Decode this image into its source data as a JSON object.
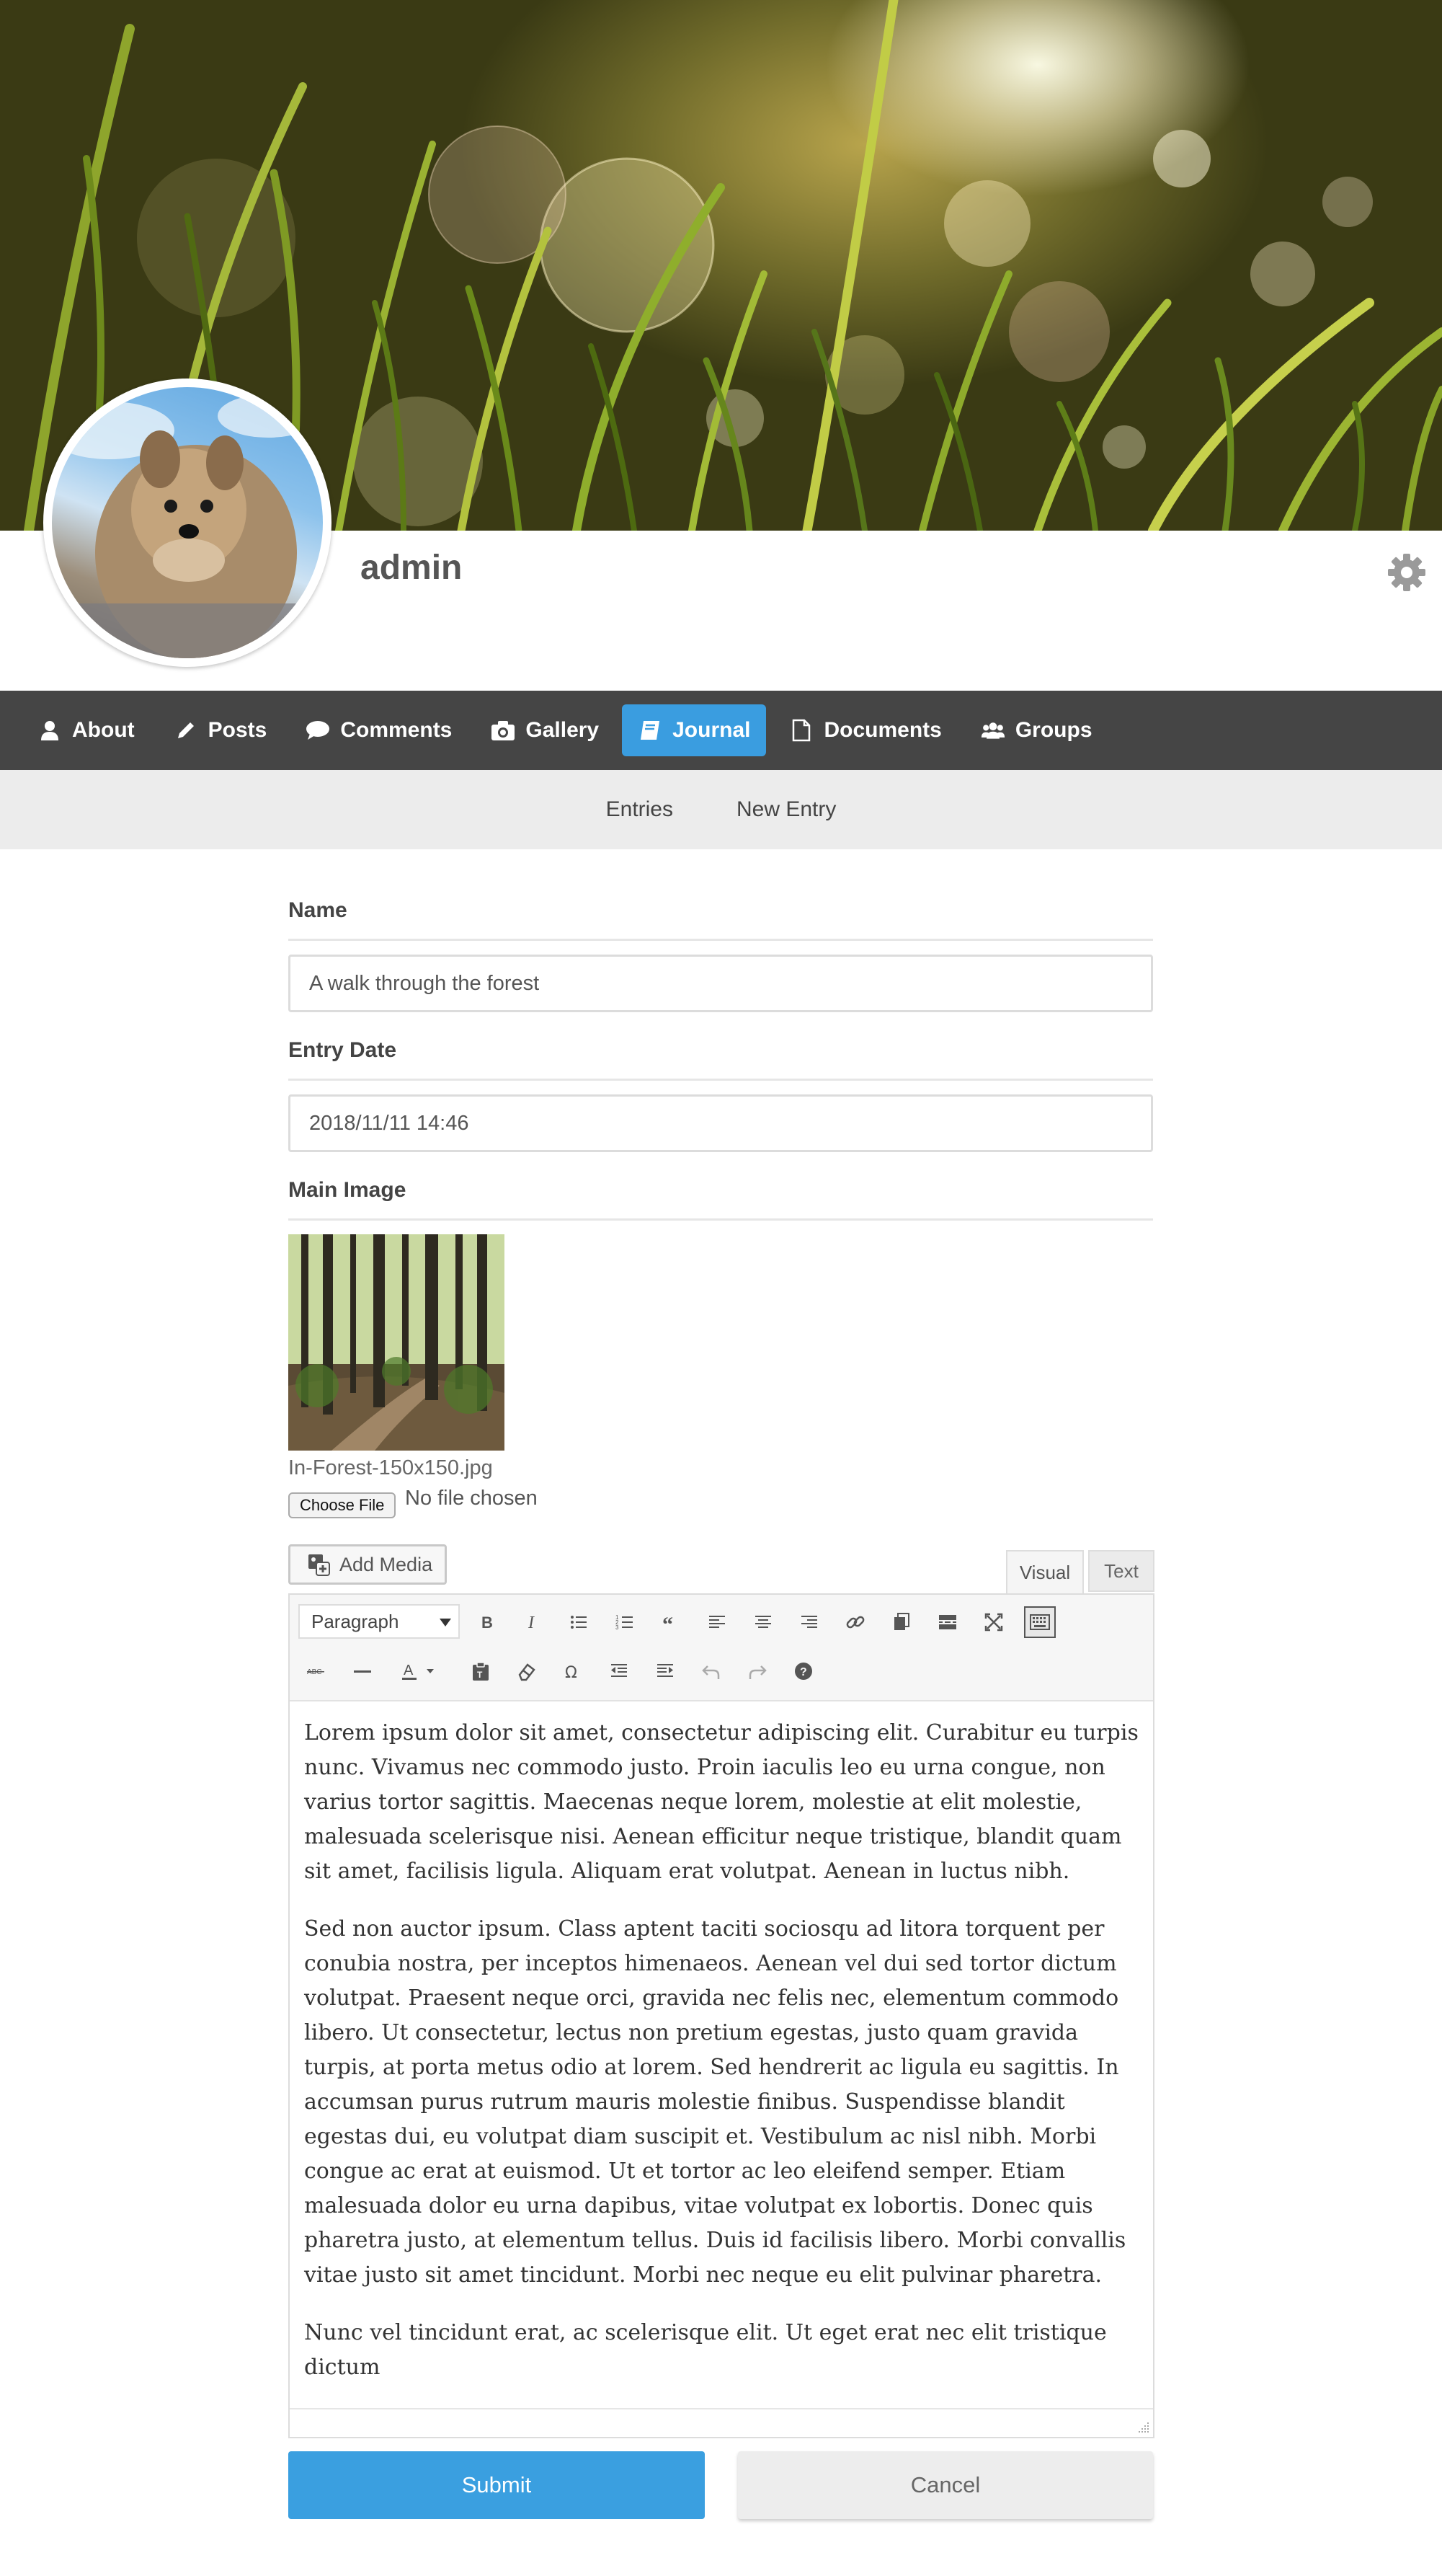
{
  "profile": {
    "username": "admin",
    "cover_image": "grass-bokeh-cover",
    "avatar_image": "yorkshire-terrier-avatar",
    "settings_icon": "gear-icon"
  },
  "nav": {
    "items": [
      {
        "label": "About",
        "icon": "user-icon",
        "active": false
      },
      {
        "label": "Posts",
        "icon": "pencil-icon",
        "active": false
      },
      {
        "label": "Comments",
        "icon": "comment-icon",
        "active": false
      },
      {
        "label": "Gallery",
        "icon": "camera-icon",
        "active": false
      },
      {
        "label": "Journal",
        "icon": "book-icon",
        "active": true
      },
      {
        "label": "Documents",
        "icon": "file-icon",
        "active": false
      },
      {
        "label": "Groups",
        "icon": "users-icon",
        "active": false
      }
    ],
    "active_color": "#3a9de0",
    "background": "#454545"
  },
  "subnav": {
    "items": [
      "Entries",
      "New Entry"
    ]
  },
  "form": {
    "name_label": "Name",
    "name_value": "A walk through the forest",
    "date_label": "Entry Date",
    "date_value": "2018/11/11 14:46",
    "image_label": "Main Image",
    "image_filename": "In-Forest-150x150.jpg",
    "choose_file_label": "Choose File",
    "no_file_text": "No file chosen"
  },
  "editor": {
    "add_media_label": "Add Media",
    "tab_visual": "Visual",
    "tab_text": "Text",
    "format_select": "Paragraph",
    "toolbar_row1": [
      "bold-icon",
      "italic-icon",
      "bullet-list-icon",
      "numbered-list-icon",
      "blockquote-icon",
      "align-left-icon",
      "align-center-icon",
      "align-right-icon",
      "link-icon",
      "copy-icon",
      "read-more-icon",
      "fullscreen-icon",
      "keyboard-toggle-icon"
    ],
    "toolbar_row2": [
      "strikethrough-icon",
      "horizontal-line-icon",
      "text-color-icon",
      "paste-text-icon",
      "clear-formatting-icon",
      "special-character-icon",
      "outdent-icon",
      "indent-icon",
      "undo-icon",
      "redo-icon",
      "help-icon"
    ],
    "paragraphs": [
      "Lorem ipsum dolor sit amet, consectetur adipiscing elit. Curabitur eu turpis nunc. Vivamus nec commodo justo. Proin iaculis leo eu urna congue, non varius tortor sagittis. Maecenas neque lorem, molestie at elit molestie, malesuada scelerisque nisi. Aenean efficitur neque tristique, blandit quam sit amet, facilisis ligula. Aliquam erat volutpat. Aenean in luctus nibh.",
      "Sed non auctor ipsum. Class aptent taciti sociosqu ad litora torquent per conubia nostra, per inceptos himenaeos. Aenean vel dui sed tortor dictum volutpat. Praesent neque orci, gravida nec felis nec, elementum commodo libero. Ut consectetur, lectus non pretium egestas, justo quam gravida turpis, at porta metus odio at lorem. Sed hendrerit ac ligula eu sagittis. In accumsan purus rutrum mauris molestie finibus. Suspendisse blandit egestas dui, eu volutpat diam suscipit et. Vestibulum ac nisl nibh. Morbi congue ac erat at euismod. Ut et tortor ac leo eleifend semper. Etiam malesuada dolor eu urna dapibus, vitae volutpat ex lobortis. Donec quis pharetra justo, at elementum tellus. Duis id facilisis libero. Morbi convallis vitae justo sit amet tincidunt. Morbi nec neque eu elit pulvinar pharetra.",
      "Nunc vel tincidunt erat, ac scelerisque elit. Ut eget erat nec elit tristique dictum"
    ]
  },
  "actions": {
    "submit_label": "Submit",
    "cancel_label": "Cancel",
    "submit_color": "#3a9fe0"
  }
}
